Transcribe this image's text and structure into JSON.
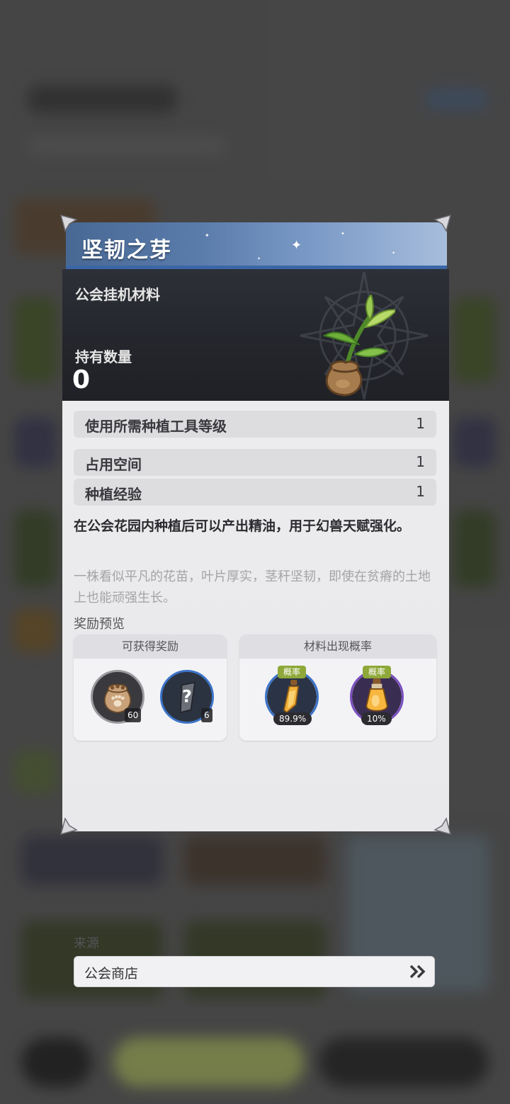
{
  "item": {
    "name": "坚韧之芽",
    "category": "公会挂机材料",
    "owned_label": "持有数量",
    "owned_value": "0"
  },
  "stats": [
    {
      "label": "使用所需种植工具等级",
      "value": "1"
    },
    {
      "label": "占用空间",
      "value": "1"
    },
    {
      "label": "种植经验",
      "value": "1"
    }
  ],
  "description": "在公会花园内种植后可以产出精油，用于幻兽天赋强化。",
  "lore": "一株看似平凡的花苗，叶片厚实，茎秆坚韧，即使在贫瘠的土地上也能顽强生长。",
  "reward_section": {
    "title": "奖励预览",
    "rewards_panel": {
      "title": "可获得奖励",
      "items": [
        {
          "icon": "seed-sack-icon",
          "count": "60"
        },
        {
          "icon": "mystery-item-icon",
          "count": "6"
        }
      ]
    },
    "chance_panel": {
      "title": "材料出现概率",
      "items": [
        {
          "icon": "essential-oil-vial-icon",
          "badge": "概率",
          "percent": "89.9%"
        },
        {
          "icon": "essential-oil-flask-icon",
          "badge": "概率",
          "percent": "10%"
        }
      ]
    }
  },
  "source_section": {
    "title": "来源",
    "entries": [
      {
        "label": "公会商店",
        "icon": "double-chevron-right-icon"
      }
    ]
  },
  "colors": {
    "title_bar": "#5a7cab",
    "header_bg": "#26282e",
    "content_bg": "#ececee",
    "blue_ring": "#3b73c8",
    "purple_ring": "#7a4fc0",
    "prob_badge": "#8fa83a"
  }
}
